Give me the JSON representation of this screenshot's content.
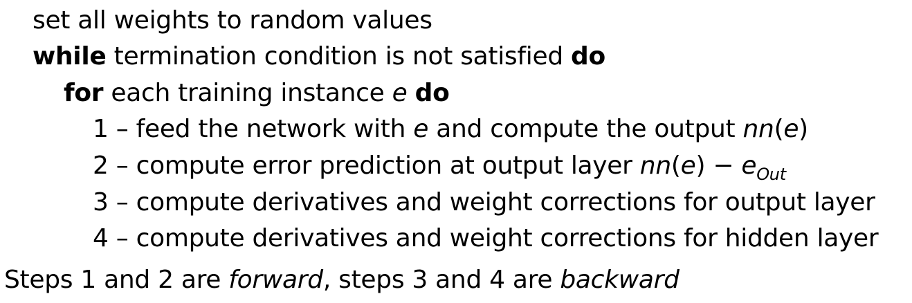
{
  "algorithm": {
    "line0": {
      "text": "set all weights to random values"
    },
    "line1": {
      "kw_while": "while",
      "text": " termination condition is not satisfied ",
      "kw_do": "do"
    },
    "line2": {
      "kw_for": "for",
      "text": " each training instance ",
      "var": "e",
      "space": " ",
      "kw_do": "do"
    },
    "step1": {
      "number": "1",
      "dash": " – ",
      "text_a": "feed the network with ",
      "var_e": "e",
      "text_b": " and compute the output ",
      "fn": "nn",
      "paren_open": "(",
      "arg": "e",
      "paren_close": ")"
    },
    "step2": {
      "number": "2",
      "dash": " – ",
      "text_a": "compute error prediction at output layer ",
      "fn": "nn",
      "paren_open": "(",
      "arg": "e",
      "paren_close": ")",
      "minus": " − ",
      "target_var": "e",
      "target_sub": "Out"
    },
    "step3": {
      "number": "3",
      "dash": " – ",
      "text": "compute derivatives and weight corrections for output layer"
    },
    "step4": {
      "number": "4",
      "dash": " – ",
      "text": "compute derivatives and weight corrections for hidden layer"
    }
  },
  "note": {
    "text_a": "Steps 1 and 2 are ",
    "em_forward": "forward",
    "text_b": ", steps 3 and 4 are ",
    "em_backward": "backward"
  }
}
